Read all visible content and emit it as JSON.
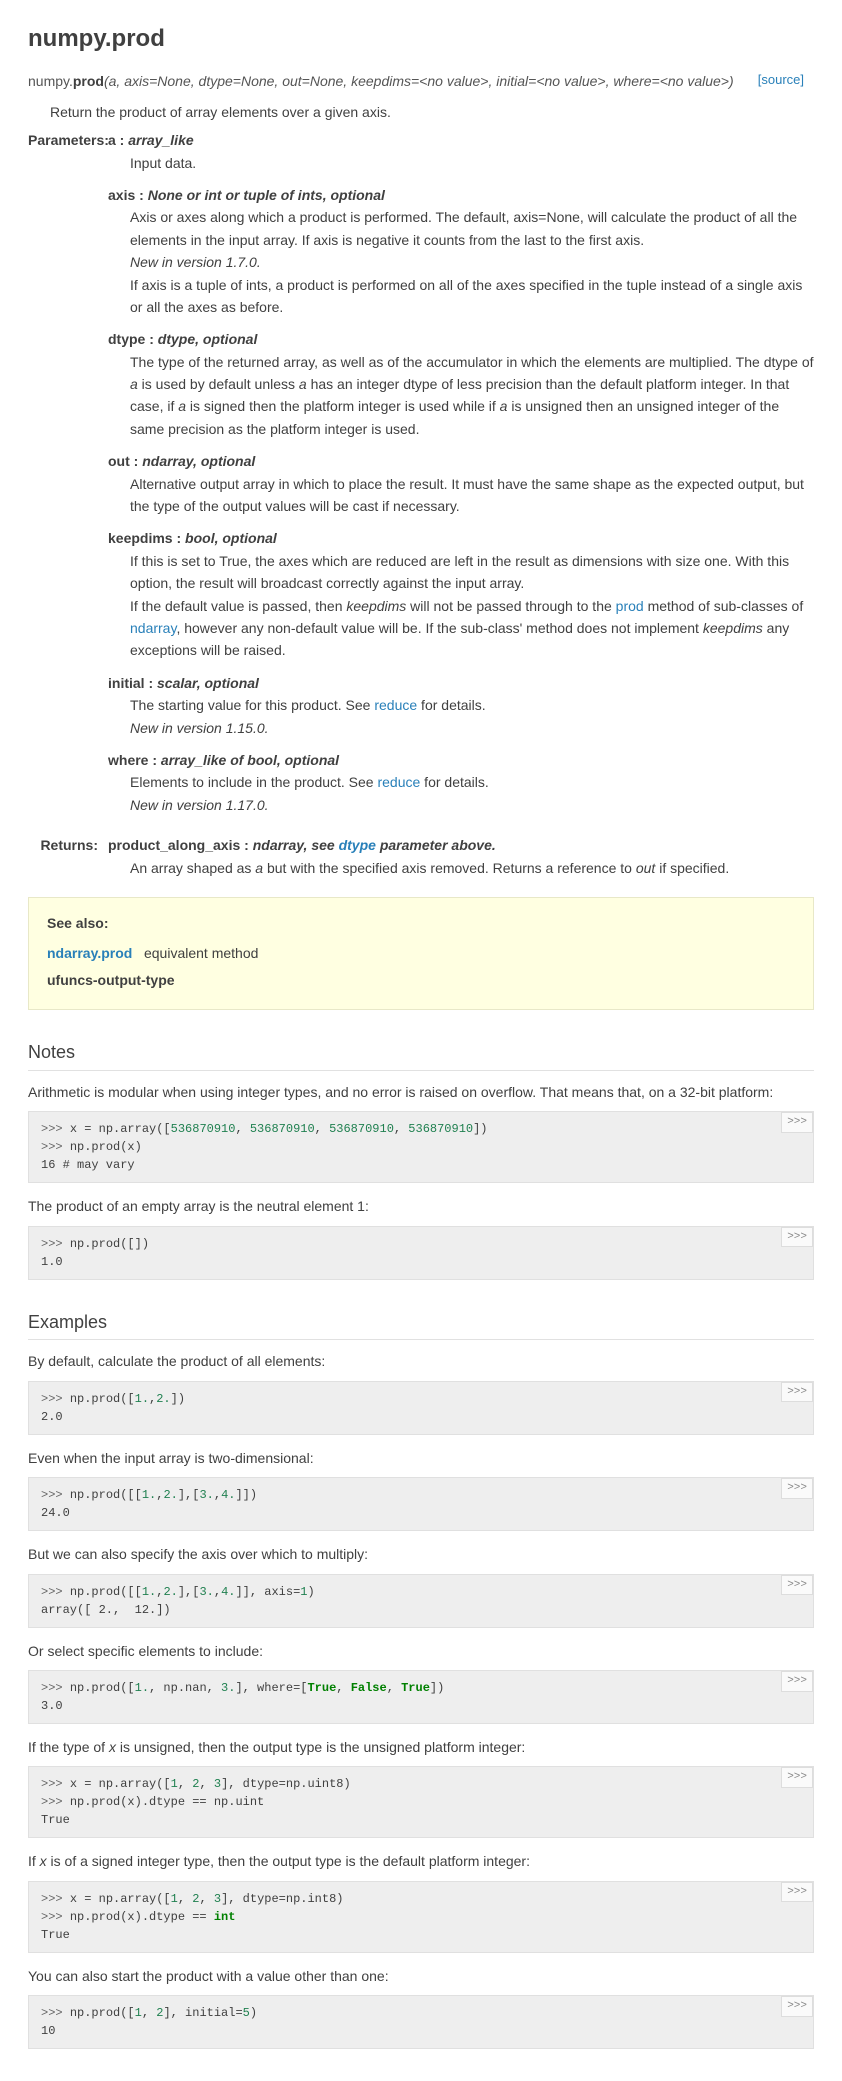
{
  "page_title": "numpy.prod",
  "sig_prefix": "numpy.",
  "sig_name": "prod",
  "sig_args": "(a, axis=None, dtype=None, out=None, keepdims=<no value>, initial=<no value>, where=<no value>)",
  "source_link": "[source]",
  "summary": "Return the product of array elements over a given axis.",
  "labels": {
    "params": "Parameters:",
    "returns": "Returns:"
  },
  "params": {
    "a": {
      "name": "a",
      "sep": " : ",
      "type": "array_like",
      "desc": "Input data."
    },
    "axis": {
      "name": "axis",
      "sep": " : ",
      "type": "None or int or tuple of ints, optional",
      "d1a": "Axis or axes along which a product is performed. The default, axis=None, will calculate the product of all the elements in the input array. If axis is negative it counts from the last to the first axis.",
      "newver": "New in version 1.7.0.",
      "d2": "If axis is a tuple of ints, a product is performed on all of the axes specified in the tuple instead of a single axis or all the axes as before."
    },
    "dtype": {
      "name": "dtype",
      "sep": " : ",
      "type": "dtype, optional",
      "p1": "The type of the returned array, as well as of the accumulator in which the elements are multiplied. The dtype of ",
      "a1": "a",
      "p2": " is used by default unless ",
      "a2": "a",
      "p3": " has an integer dtype of less precision than the default platform integer. In that case, if ",
      "a3": "a",
      "p4": " is signed then the platform integer is used while if ",
      "a4": "a",
      "p5": " is unsigned then an unsigned integer of the same precision as the platform integer is used."
    },
    "out": {
      "name": "out",
      "sep": " : ",
      "type": "ndarray, optional",
      "desc": "Alternative output array in which to place the result. It must have the same shape as the expected output, but the type of the output values will be cast if necessary."
    },
    "keepdims": {
      "name": "keepdims",
      "sep": " : ",
      "type": "bool, optional",
      "d1": "If this is set to True, the axes which are reduced are left in the result as dimensions with size one. With this option, the result will broadcast correctly against the input array.",
      "p1": "If the default value is passed, then ",
      "kd1": "keepdims",
      "p2": " will not be passed through to the ",
      "prod": "prod",
      "p3": " method of sub-classes of ",
      "ndarray": "ndarray",
      "p4": ", however any non-default value will be. If the sub-class' method does not implement ",
      "kd2": "keepdims",
      "p5": " any exceptions will be raised."
    },
    "initial": {
      "name": "initial",
      "sep": " : ",
      "type": "scalar, optional",
      "p1": "The starting value for this product. See ",
      "reduce": "reduce",
      "p2": " for details.",
      "newver": "New in version 1.15.0."
    },
    "where": {
      "name": "where",
      "sep": " : ",
      "type": "array_like of bool, optional",
      "p1": "Elements to include in the product. See ",
      "reduce": "reduce",
      "p2": " for details.",
      "newver": "New in version 1.17.0."
    }
  },
  "returns": {
    "name": "product_along_axis",
    "sep": " : ",
    "t1": "ndarray, see ",
    "dtype": "dtype",
    "t2": " parameter above.",
    "d1": "An array shaped as ",
    "a": "a",
    "d2": " but with the specified axis removed. Returns a reference to ",
    "out": "out",
    "d3": " if specified."
  },
  "seealso": {
    "title": "See also:",
    "prod": "ndarray.prod",
    "prod_desc": "equivalent method",
    "uot": "ufuncs-output-type"
  },
  "notes_title": "Notes",
  "notes_p1": "Arithmetic is modular when using integer types, and no error is raised on overflow. That means that, on a 32-bit platform:",
  "notes_p2": "The product of an empty array is the neutral element 1:",
  "examples_title": "Examples",
  "ex": {
    "p1": "By default, calculate the product of all elements:",
    "p2": "Even when the input array is two-dimensional:",
    "p3": "But we can also specify the axis over which to multiply:",
    "p4": "Or select specific elements to include:",
    "p5a": "If the type of ",
    "p5x": "x",
    "p5b": " is unsigned, then the output type is the unsigned platform integer:",
    "p6a": "If ",
    "p6x": "x",
    "p6b": " is of a signed integer type, then the output type is the default platform integer:",
    "p7": "You can also start the product with a value other than one:"
  },
  "toggle": ">>>",
  "code": {
    "n1l1a": ">>> ",
    "n1l1b": "x = np.array([",
    "n1l1c": "536870910",
    "n1l1d": ", ",
    "n1l1e": "536870910",
    "n1l1f": ", ",
    "n1l1g": "536870910",
    "n1l1h": ", ",
    "n1l1i": "536870910",
    "n1l1j": "])",
    "n1l2a": ">>> ",
    "n1l2b": "np.prod(x)",
    "n1l3": "16 # may vary",
    "n2l1a": ">>> ",
    "n2l1b": "np.prod([])",
    "n2l2": "1.0",
    "e1l1a": ">>> ",
    "e1l1b": "np.prod([",
    "e1l1c": "1.",
    "e1l1d": ",",
    "e1l1e": "2.",
    "e1l1f": "])",
    "e1l2": "2.0",
    "e2l1a": ">>> ",
    "e2l1b": "np.prod([[",
    "e2l1c": "1.",
    "e2l1d": ",",
    "e2l1e": "2.",
    "e2l1f": "],[",
    "e2l1g": "3.",
    "e2l1h": ",",
    "e2l1i": "4.",
    "e2l1j": "]])",
    "e2l2": "24.0",
    "e3l1a": ">>> ",
    "e3l1b": "np.prod([[",
    "e3l1c": "1.",
    "e3l1d": ",",
    "e3l1e": "2.",
    "e3l1f": "],[",
    "e3l1g": "3.",
    "e3l1h": ",",
    "e3l1i": "4.",
    "e3l1j": "]], axis=",
    "e3l1k": "1",
    "e3l1l": ")",
    "e3l2": "array([ 2.,  12.])",
    "e4l1a": ">>> ",
    "e4l1b": "np.prod([",
    "e4l1c": "1.",
    "e4l1d": ", np.nan, ",
    "e4l1e": "3.",
    "e4l1f": "], where=[",
    "e4l1g": "True",
    "e4l1h": ", ",
    "e4l1i": "False",
    "e4l1j": ", ",
    "e4l1k": "True",
    "e4l1l": "])",
    "e4l2": "3.0",
    "e5l1a": ">>> ",
    "e5l1b": "x = np.array([",
    "e5l1c": "1",
    "e5l1d": ", ",
    "e5l1e": "2",
    "e5l1f": ", ",
    "e5l1g": "3",
    "e5l1h": "], dtype=np.uint8)",
    "e5l2a": ">>> ",
    "e5l2b": "np.prod(x).dtype == np.uint",
    "e5l3": "True",
    "e6l1a": ">>> ",
    "e6l1b": "x = np.array([",
    "e6l1c": "1",
    "e6l1d": ", ",
    "e6l1e": "2",
    "e6l1f": ", ",
    "e6l1g": "3",
    "e6l1h": "], dtype=np.int8)",
    "e6l2a": ">>> ",
    "e6l2b": "np.prod(x).dtype == ",
    "e6l2c": "int",
    "e6l3": "True",
    "e7l1a": ">>> ",
    "e7l1b": "np.prod([",
    "e7l1c": "1",
    "e7l1d": ", ",
    "e7l1e": "2",
    "e7l1f": "], initial=",
    "e7l1g": "5",
    "e7l1h": ")",
    "e7l2": "10"
  }
}
